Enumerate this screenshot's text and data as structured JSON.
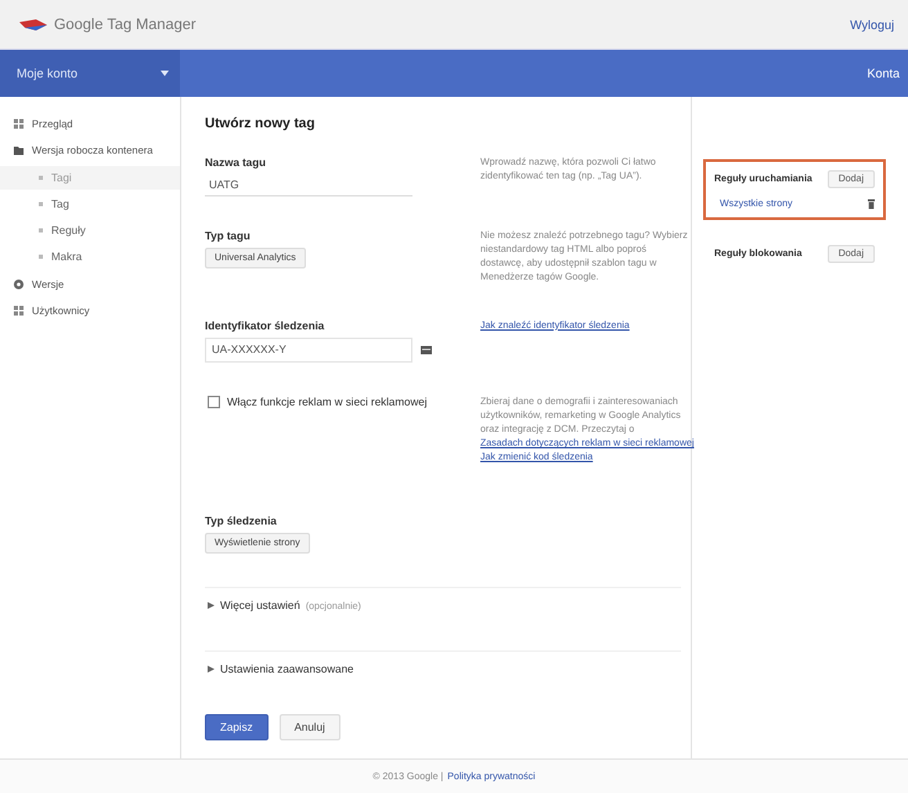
{
  "header": {
    "logo": "Google Tag Manager",
    "sign_out": "Wyloguj"
  },
  "navbar": {
    "account_menu": "Moje konto",
    "right_link": "Konta"
  },
  "sidebar": {
    "items": [
      {
        "label": "Przegląd",
        "selected": false
      },
      {
        "label": "Wersja robocza kontenera",
        "selected": false,
        "children": [
          {
            "label": "Tagi",
            "selected": true
          },
          {
            "label": "Tag",
            "selected": false
          },
          {
            "label": "Reguły",
            "selected": false
          },
          {
            "label": "Makra",
            "selected": false
          }
        ]
      },
      {
        "label": "Wersje",
        "selected": false
      },
      {
        "label": "Użytkownicy",
        "selected": false
      }
    ]
  },
  "form": {
    "title": "Utwórz nowy tag",
    "rows": [
      {
        "kind": "text",
        "label": "Nazwa tagu",
        "value": "UATG",
        "help": {
          "text": "Wprowadź nazwę, która pozwoli Ci łatwo zidentyfikować ten tag (np. „Tag UA”)."
        }
      },
      {
        "kind": "select",
        "label": "Typ tagu",
        "value": "Universal Analytics",
        "help": {
          "text": "Nie możesz znaleźć potrzebnego tagu? Wybierz niestandardowy tag HTML albo poproś dostawcę, aby udostępnił szablon tagu w Menedżerze tagów Google."
        }
      },
      {
        "kind": "icon-input",
        "label": "Identyfikator śledzenia",
        "value": "UA-XXXXXX-Y",
        "help": {
          "links": [
            "Jak znaleźć identyfikator śledzenia"
          ]
        }
      },
      {
        "kind": "checkbox",
        "label": "Włącz funkcje reklam w sieci reklamowej",
        "checked": false,
        "help": {
          "text": "Zbieraj dane o demografii i zainteresowaniach użytkowników, remarketing w Google Analytics oraz integrację z DCM. Przeczytaj o",
          "links": [
            "Zasadach dotyczących reklam w sieci reklamowej",
            "Jak zmienić kod śledzenia"
          ]
        }
      },
      {
        "kind": "select",
        "label": "Typ śledzenia",
        "value": "Wyświetlenie strony"
      },
      {
        "kind": "section",
        "label": "Więcej ustawień",
        "note": "(opcjonalnie)",
        "expanded": false
      },
      {
        "kind": "section",
        "label": "Ustawienia zaawansowane",
        "expanded": false
      }
    ],
    "buttons": [
      {
        "label": "Zapisz",
        "primary": true
      },
      {
        "label": "Anuluj",
        "primary": false
      }
    ]
  },
  "rules": [
    {
      "title": "Reguły uruchamiania",
      "button": "Dodaj",
      "highlighted": true,
      "items": [
        "Wszystkie strony"
      ]
    },
    {
      "title": "Reguły blokowania",
      "button": "Dodaj",
      "highlighted": false
    }
  ],
  "footer": {
    "copyright": "© 2013 Google |",
    "link": "Polityka prywatności"
  }
}
